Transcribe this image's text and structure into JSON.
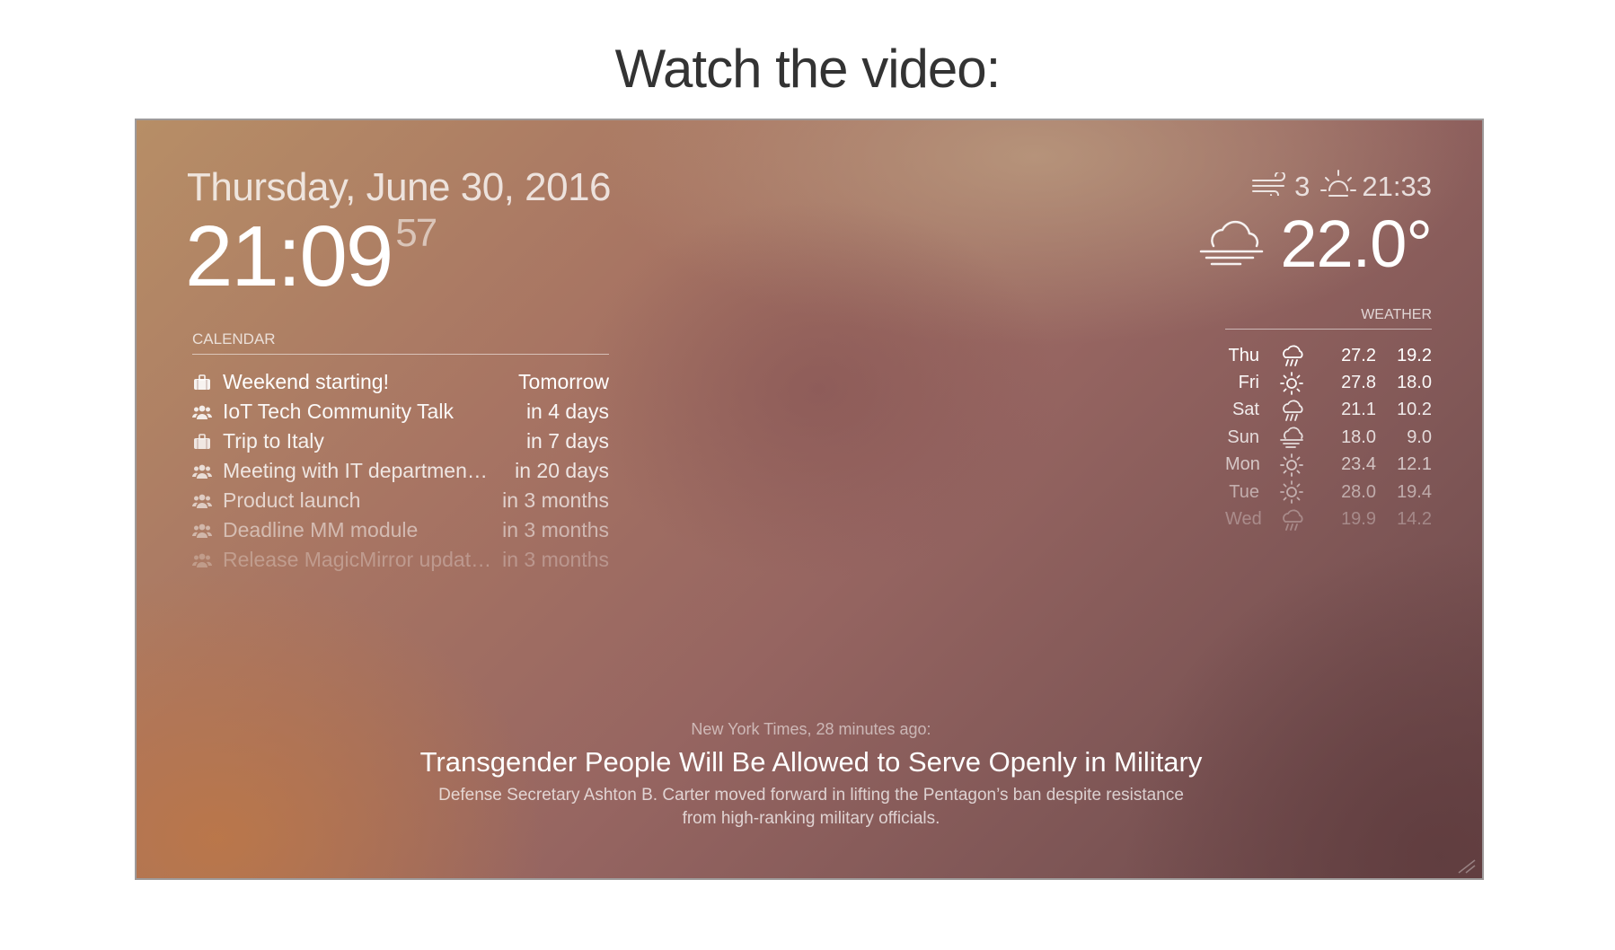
{
  "page": {
    "heading": "Watch the video:"
  },
  "mirror": {
    "date": "Thursday, June 30, 2016",
    "clock": {
      "time": "21:09",
      "seconds": "57"
    },
    "calendar": {
      "header": "CALENDAR",
      "events": [
        {
          "icon": "suitcase-icon",
          "title": "Weekend starting!",
          "when": "Tomorrow",
          "opacity": 1.0
        },
        {
          "icon": "group-icon",
          "title": "IoT Tech Community Talk",
          "when": "in 4 days",
          "opacity": 0.95
        },
        {
          "icon": "suitcase-icon",
          "title": "Trip to Italy",
          "when": "in 7 days",
          "opacity": 0.9
        },
        {
          "icon": "group-icon",
          "title": "Meeting with IT departmen…",
          "when": "in 20 days",
          "opacity": 0.82
        },
        {
          "icon": "group-icon",
          "title": "Product launch",
          "when": "in 3 months",
          "opacity": 0.68
        },
        {
          "icon": "group-icon",
          "title": "Deadline MM module",
          "when": "in 3 months",
          "opacity": 0.5
        },
        {
          "icon": "group-icon",
          "title": "Release MagicMirror updat…",
          "when": "in 3 months",
          "opacity": 0.28
        }
      ]
    },
    "weather": {
      "wind": "3",
      "sunset": "21:33",
      "temperature": "22.0°",
      "current_icon": "fog-icon",
      "forecast_header": "WEATHER",
      "forecast": [
        {
          "day": "Thu",
          "icon": "rain-icon",
          "max": "27.2",
          "min": "19.2",
          "opacity": 1.0
        },
        {
          "day": "Fri",
          "icon": "sun-icon",
          "max": "27.8",
          "min": "18.0",
          "opacity": 0.95
        },
        {
          "day": "Sat",
          "icon": "rain-icon",
          "max": "21.1",
          "min": "10.2",
          "opacity": 0.88
        },
        {
          "day": "Sun",
          "icon": "fog-icon",
          "max": "18.0",
          "min": "9.0",
          "opacity": 0.78
        },
        {
          "day": "Mon",
          "icon": "sun-icon",
          "max": "23.4",
          "min": "12.1",
          "opacity": 0.65
        },
        {
          "day": "Tue",
          "icon": "sun-icon",
          "max": "28.0",
          "min": "19.4",
          "opacity": 0.5
        },
        {
          "day": "Wed",
          "icon": "rain-icon",
          "max": "19.9",
          "min": "14.2",
          "opacity": 0.3
        }
      ]
    },
    "news": {
      "source": "New York Times, 28 minutes ago:",
      "headline": "Transgender People Will Be Allowed to Serve Openly in Military",
      "description": "Defense Secretary Ashton B. Carter moved forward in lifting the Pentagon’s ban despite resistance from high-ranking military officials."
    }
  }
}
